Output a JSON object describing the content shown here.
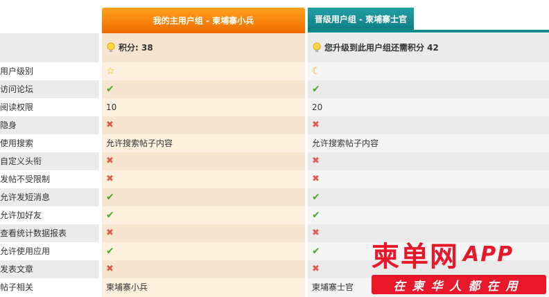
{
  "header": {
    "current_group_tab": "我的主用户组 - 柬埔寨小兵",
    "upgrade_group_tab": "晋级用户组 - 柬埔寨士官"
  },
  "points": {
    "current": "积分: 38",
    "upgrade": "您升级到此用户组还需积分 42"
  },
  "rows": [
    {
      "label": "用户级别",
      "current": "star-icon",
      "upgrade": "moon-icon"
    },
    {
      "label": "访问论坛",
      "current": "check-icon",
      "upgrade": "check-icon"
    },
    {
      "label": "阅读权限",
      "current": "10",
      "upgrade": "20"
    },
    {
      "label": "隐身",
      "current": "cross-icon",
      "upgrade": "cross-icon"
    },
    {
      "label": "使用搜索",
      "current": "允许搜索帖子内容",
      "upgrade": "允许搜索帖子内容"
    },
    {
      "label": "自定义头衔",
      "current": "cross-icon",
      "upgrade": "cross-icon"
    },
    {
      "label": "发帖不受限制",
      "current": "cross-icon",
      "upgrade": "cross-icon"
    },
    {
      "label": "允许发短消息",
      "current": "check-icon",
      "upgrade": "check-icon"
    },
    {
      "label": "允许加好友",
      "current": "check-icon",
      "upgrade": "check-icon"
    },
    {
      "label": "查看统计数据报表",
      "current": "cross-icon",
      "upgrade": "cross-icon"
    },
    {
      "label": "允许使用应用",
      "current": "check-icon",
      "upgrade": "check-icon"
    },
    {
      "label": "发表文章",
      "current": "cross-icon",
      "upgrade": "cross-icon"
    },
    {
      "label": "帖子相关",
      "current": "柬埔寨小兵",
      "upgrade": "柬埔寨士官"
    }
  ],
  "watermark": {
    "title": "柬单网",
    "app": "APP",
    "slogan": "在柬华人都在用"
  },
  "colors": {
    "orange": "#f06a00",
    "teal": "#10898c",
    "check": "#4aa82a",
    "cross": "#e05a4a",
    "brand_red": "#e8182a"
  }
}
